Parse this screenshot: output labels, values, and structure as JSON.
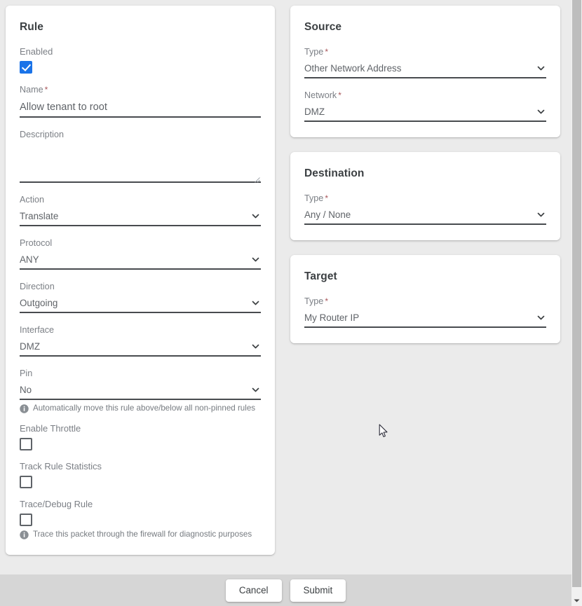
{
  "rule_card": {
    "title": "Rule",
    "enabled": {
      "label": "Enabled",
      "checked": true
    },
    "name": {
      "label": "Name",
      "required": true,
      "value": "Allow tenant to root"
    },
    "description": {
      "label": "Description",
      "required": false,
      "value": ""
    },
    "action": {
      "label": "Action",
      "value": "Translate"
    },
    "protocol": {
      "label": "Protocol",
      "value": "ANY"
    },
    "direction": {
      "label": "Direction",
      "value": "Outgoing"
    },
    "interface": {
      "label": "Interface",
      "value": "DMZ"
    },
    "pin": {
      "label": "Pin",
      "value": "No"
    },
    "pin_hint": "Automatically move this rule above/below all non-pinned rules",
    "enable_throttle": {
      "label": "Enable Throttle",
      "checked": false
    },
    "track_rule_statistics": {
      "label": "Track Rule Statistics",
      "checked": false
    },
    "trace_debug_rule": {
      "label": "Trace/Debug Rule",
      "checked": false
    },
    "trace_hint": "Trace this packet through the firewall for diagnostic purposes"
  },
  "source_card": {
    "title": "Source",
    "type": {
      "label": "Type",
      "required": true,
      "value": "Other Network Address"
    },
    "network": {
      "label": "Network",
      "required": true,
      "value": "DMZ"
    }
  },
  "destination_card": {
    "title": "Destination",
    "type": {
      "label": "Type",
      "required": true,
      "value": "Any / None"
    }
  },
  "target_card": {
    "title": "Target",
    "type": {
      "label": "Type",
      "required": true,
      "value": "My Router IP"
    }
  },
  "footer": {
    "cancel_label": "Cancel",
    "submit_label": "Submit"
  },
  "icons": {
    "required_marker": "*",
    "chevron_down": "chevron-down-icon",
    "info": "info-icon",
    "resize_grip": "resize-grip-icon",
    "scroll_down_arrow": "scroll-down-arrow-icon",
    "mouse_pointer": "mouse-pointer-cursor"
  },
  "colors": {
    "page_background": "#ebebeb",
    "card_background": "#ffffff",
    "footer_background": "#d6d6d6",
    "checkbox_checked": "#1a73e8",
    "required_asterisk": "#a8565a",
    "label_text": "#7b7f85",
    "value_text": "#5f6368",
    "underline": "#484b4f",
    "scrollbar_thumb": "#bdbdbd"
  }
}
